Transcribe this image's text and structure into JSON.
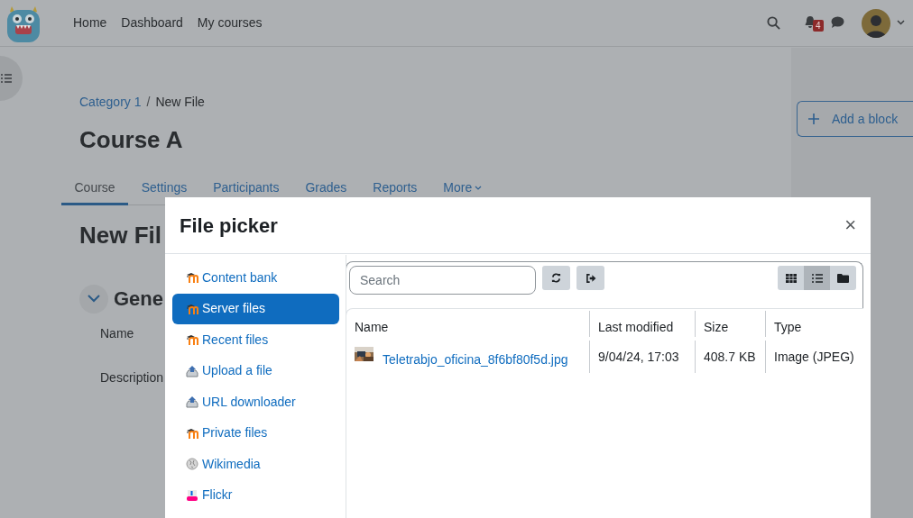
{
  "nav": {
    "links": [
      "Home",
      "Dashboard",
      "My courses"
    ],
    "notification_count": "4"
  },
  "breadcrumb": {
    "separator": "/",
    "items": [
      "Category 1",
      "New File"
    ]
  },
  "course_title": "Course A",
  "tabs": [
    {
      "label": "Course",
      "selected": true
    },
    {
      "label": "Settings",
      "selected": false
    },
    {
      "label": "Participants",
      "selected": false
    },
    {
      "label": "Grades",
      "selected": false
    },
    {
      "label": "Reports",
      "selected": false
    },
    {
      "label": "More",
      "selected": false,
      "dropdown": true
    }
  ],
  "page_heading": "New Fil",
  "section_heading": "Gene",
  "form_labels": [
    "Name",
    "Description"
  ],
  "add_block": "Add a block",
  "modal": {
    "title": "File picker",
    "close": "×",
    "repositories": [
      {
        "label": "Content bank",
        "kind": "moodle",
        "selected": false
      },
      {
        "label": "Server files",
        "kind": "moodle",
        "selected": true
      },
      {
        "label": "Recent files",
        "kind": "moodle",
        "selected": false
      },
      {
        "label": "Upload a file",
        "kind": "upload",
        "selected": false
      },
      {
        "label": "URL downloader",
        "kind": "upload",
        "selected": false
      },
      {
        "label": "Private files",
        "kind": "moodle",
        "selected": false
      },
      {
        "label": "Wikimedia",
        "kind": "wikimedia",
        "selected": false
      },
      {
        "label": "Flickr",
        "kind": "flickr",
        "selected": false
      }
    ],
    "search": {
      "placeholder": "Search"
    },
    "view_modes": [
      {
        "kind": "icons",
        "selected": false
      },
      {
        "kind": "list",
        "selected": true
      },
      {
        "kind": "tree",
        "selected": false
      }
    ],
    "table": {
      "columns": [
        "Name",
        "Last modified",
        "Size",
        "Type"
      ],
      "rows": [
        {
          "name": "Teletrabjo_oficina_8f6bf80f5d.jpg",
          "modified": "9/04/24, 17:03",
          "size": "408.7 KB",
          "type": "Image (JPEG)"
        }
      ]
    }
  }
}
